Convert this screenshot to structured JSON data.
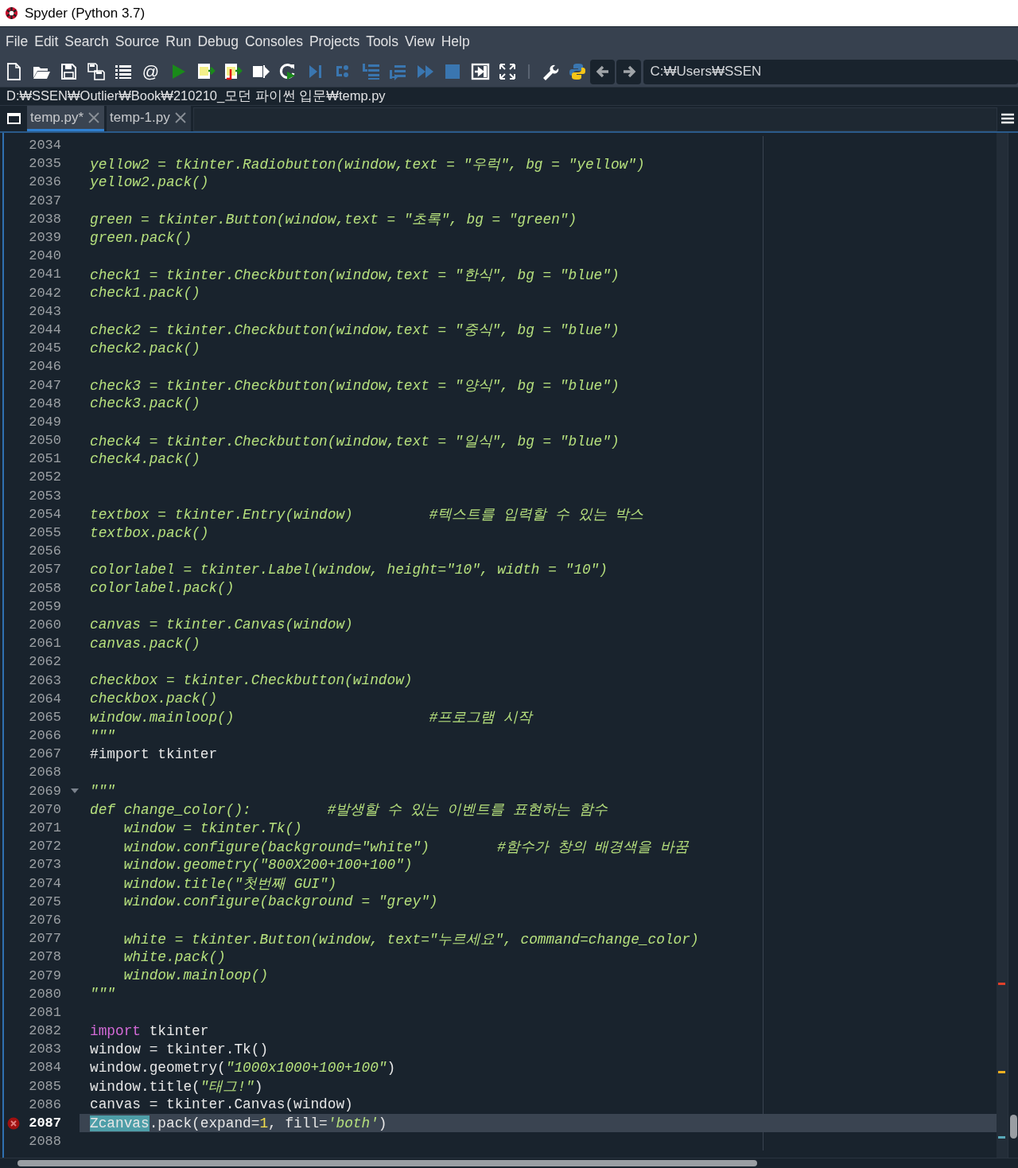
{
  "window": {
    "title": "Spyder (Python 3.7)"
  },
  "menu": [
    "File",
    "Edit",
    "Search",
    "Source",
    "Run",
    "Debug",
    "Consoles",
    "Projects",
    "Tools",
    "View",
    "Help"
  ],
  "toolbar": {
    "at_symbol": "@",
    "working_directory": "C:₩Users₩SSEN"
  },
  "file_path": "D:₩SSEN₩Outlier₩Book₩210210_모던 파이썬 입문₩temp.py",
  "tabs": [
    {
      "label": "temp.py*",
      "selected": true
    },
    {
      "label": "temp-1.py",
      "selected": false
    }
  ],
  "editor": {
    "lines": [
      {
        "number": "2034",
        "current": false,
        "error": false,
        "fold": false
      },
      {
        "number": "2035",
        "current": false,
        "error": false,
        "fold": false,
        "segments": [
          {
            "text": "yellow2 = tkinter.Radiobutton(window,text = \"우럭\", bg = \"yellow\")",
            "kind": "string"
          }
        ]
      },
      {
        "number": "2036",
        "current": false,
        "error": false,
        "fold": false,
        "segments": [
          {
            "text": "yellow2.pack()",
            "kind": "string"
          }
        ]
      },
      {
        "number": "2037",
        "current": false,
        "error": false,
        "fold": false
      },
      {
        "number": "2038",
        "current": false,
        "error": false,
        "fold": false,
        "segments": [
          {
            "text": "green = tkinter.Button(window,text = \"초록\", bg = \"green\")",
            "kind": "string"
          }
        ]
      },
      {
        "number": "2039",
        "current": false,
        "error": false,
        "fold": false,
        "segments": [
          {
            "text": "green.pack()",
            "kind": "string"
          }
        ]
      },
      {
        "number": "2040",
        "current": false,
        "error": false,
        "fold": false
      },
      {
        "number": "2041",
        "current": false,
        "error": false,
        "fold": false,
        "segments": [
          {
            "text": "check1 = tkinter.Checkbutton(window,text = \"한식\", bg = \"blue\")",
            "kind": "string"
          }
        ]
      },
      {
        "number": "2042",
        "current": false,
        "error": false,
        "fold": false,
        "segments": [
          {
            "text": "check1.pack()",
            "kind": "string"
          }
        ]
      },
      {
        "number": "2043",
        "current": false,
        "error": false,
        "fold": false
      },
      {
        "number": "2044",
        "current": false,
        "error": false,
        "fold": false,
        "segments": [
          {
            "text": "check2 = tkinter.Checkbutton(window,text = \"중식\", bg = \"blue\")",
            "kind": "string"
          }
        ]
      },
      {
        "number": "2045",
        "current": false,
        "error": false,
        "fold": false,
        "segments": [
          {
            "text": "check2.pack()",
            "kind": "string"
          }
        ]
      },
      {
        "number": "2046",
        "current": false,
        "error": false,
        "fold": false
      },
      {
        "number": "2047",
        "current": false,
        "error": false,
        "fold": false,
        "segments": [
          {
            "text": "check3 = tkinter.Checkbutton(window,text = \"양식\", bg = \"blue\")",
            "kind": "string"
          }
        ]
      },
      {
        "number": "2048",
        "current": false,
        "error": false,
        "fold": false,
        "segments": [
          {
            "text": "check3.pack()",
            "kind": "string"
          }
        ]
      },
      {
        "number": "2049",
        "current": false,
        "error": false,
        "fold": false
      },
      {
        "number": "2050",
        "current": false,
        "error": false,
        "fold": false,
        "segments": [
          {
            "text": "check4 = tkinter.Checkbutton(window,text = \"일식\", bg = \"blue\")",
            "kind": "string"
          }
        ]
      },
      {
        "number": "2051",
        "current": false,
        "error": false,
        "fold": false,
        "segments": [
          {
            "text": "check4.pack()",
            "kind": "string"
          }
        ]
      },
      {
        "number": "2052",
        "current": false,
        "error": false,
        "fold": false
      },
      {
        "number": "2053",
        "current": false,
        "error": false,
        "fold": false
      },
      {
        "number": "2054",
        "current": false,
        "error": false,
        "fold": false,
        "segments": [
          {
            "text": "textbox = tkinter.Entry(window)         #텍스트를 입력할 수 있는 박스",
            "kind": "string"
          }
        ]
      },
      {
        "number": "2055",
        "current": false,
        "error": false,
        "fold": false,
        "segments": [
          {
            "text": "textbox.pack()",
            "kind": "string"
          }
        ]
      },
      {
        "number": "2056",
        "current": false,
        "error": false,
        "fold": false
      },
      {
        "number": "2057",
        "current": false,
        "error": false,
        "fold": false,
        "segments": [
          {
            "text": "colorlabel = tkinter.Label(window, height=\"10\", width = \"10\")",
            "kind": "string"
          }
        ]
      },
      {
        "number": "2058",
        "current": false,
        "error": false,
        "fold": false,
        "segments": [
          {
            "text": "colorlabel.pack()",
            "kind": "string"
          }
        ]
      },
      {
        "number": "2059",
        "current": false,
        "error": false,
        "fold": false
      },
      {
        "number": "2060",
        "current": false,
        "error": false,
        "fold": false,
        "segments": [
          {
            "text": "canvas = tkinter.Canvas(window)",
            "kind": "string"
          }
        ]
      },
      {
        "number": "2061",
        "current": false,
        "error": false,
        "fold": false,
        "segments": [
          {
            "text": "canvas.pack()",
            "kind": "string"
          }
        ]
      },
      {
        "number": "2062",
        "current": false,
        "error": false,
        "fold": false
      },
      {
        "number": "2063",
        "current": false,
        "error": false,
        "fold": false,
        "segments": [
          {
            "text": "checkbox = tkinter.Checkbutton(window)",
            "kind": "string"
          }
        ]
      },
      {
        "number": "2064",
        "current": false,
        "error": false,
        "fold": false,
        "segments": [
          {
            "text": "checkbox.pack()",
            "kind": "string"
          }
        ]
      },
      {
        "number": "2065",
        "current": false,
        "error": false,
        "fold": false,
        "segments": [
          {
            "text": "window.mainloop()                       #프로그램 시작",
            "kind": "string"
          }
        ]
      },
      {
        "number": "2066",
        "current": false,
        "error": false,
        "fold": false,
        "segments": [
          {
            "text": "\"\"\"",
            "kind": "string"
          }
        ]
      },
      {
        "number": "2067",
        "current": false,
        "error": false,
        "fold": false,
        "segments": [
          {
            "text": "#import tkinter",
            "kind": "plain"
          }
        ]
      },
      {
        "number": "2068",
        "current": false,
        "error": false,
        "fold": false
      },
      {
        "number": "2069",
        "current": false,
        "error": false,
        "fold": true,
        "segments": [
          {
            "text": "\"\"\"",
            "kind": "string"
          }
        ]
      },
      {
        "number": "2070",
        "current": false,
        "error": false,
        "fold": false,
        "segments": [
          {
            "text": "def change_color():         #발생할 수 있는 이벤트를 표현하는 함수",
            "kind": "string"
          }
        ]
      },
      {
        "number": "2071",
        "current": false,
        "error": false,
        "fold": false,
        "segments": [
          {
            "text": "    window = tkinter.Tk()",
            "kind": "string"
          }
        ]
      },
      {
        "number": "2072",
        "current": false,
        "error": false,
        "fold": false,
        "segments": [
          {
            "text": "    window.configure(background=\"white\")        #함수가 창의 배경색을 바꿈",
            "kind": "string"
          }
        ]
      },
      {
        "number": "2073",
        "current": false,
        "error": false,
        "fold": false,
        "segments": [
          {
            "text": "    window.geometry(\"800X200+100+100\")",
            "kind": "string"
          }
        ]
      },
      {
        "number": "2074",
        "current": false,
        "error": false,
        "fold": false,
        "segments": [
          {
            "text": "    window.title(\"첫번째 GUI\")",
            "kind": "string"
          }
        ]
      },
      {
        "number": "2075",
        "current": false,
        "error": false,
        "fold": false,
        "segments": [
          {
            "text": "    window.configure(background = \"grey\")",
            "kind": "string"
          }
        ]
      },
      {
        "number": "2076",
        "current": false,
        "error": false,
        "fold": false
      },
      {
        "number": "2077",
        "current": false,
        "error": false,
        "fold": false,
        "segments": [
          {
            "text": "    white = tkinter.Button(window, text=\"누르세요\", command=change_color)",
            "kind": "string"
          }
        ]
      },
      {
        "number": "2078",
        "current": false,
        "error": false,
        "fold": false,
        "segments": [
          {
            "text": "    white.pack()",
            "kind": "string"
          }
        ]
      },
      {
        "number": "2079",
        "current": false,
        "error": false,
        "fold": false,
        "segments": [
          {
            "text": "    window.mainloop()",
            "kind": "string"
          }
        ]
      },
      {
        "number": "2080",
        "current": false,
        "error": false,
        "fold": false,
        "segments": [
          {
            "text": "\"\"\"",
            "kind": "string"
          }
        ]
      },
      {
        "number": "2081",
        "current": false,
        "error": false,
        "fold": false
      },
      {
        "number": "2082",
        "current": false,
        "error": false,
        "fold": false,
        "segments": [
          {
            "text": "import",
            "kind": "keyword"
          },
          {
            "text": " tkinter",
            "kind": "plain"
          }
        ]
      },
      {
        "number": "2083",
        "current": false,
        "error": false,
        "fold": false,
        "segments": [
          {
            "text": "window = tkinter.Tk()",
            "kind": "plain"
          }
        ]
      },
      {
        "number": "2084",
        "current": false,
        "error": false,
        "fold": false,
        "segments": [
          {
            "text": "window.geometry(",
            "kind": "plain"
          },
          {
            "text": "\"1000x1000+100+100\"",
            "kind": "string"
          },
          {
            "text": ")",
            "kind": "plain"
          }
        ]
      },
      {
        "number": "2085",
        "current": false,
        "error": false,
        "fold": false,
        "segments": [
          {
            "text": "window.title(",
            "kind": "plain"
          },
          {
            "text": "\"태그!\"",
            "kind": "string"
          },
          {
            "text": ")",
            "kind": "plain"
          }
        ]
      },
      {
        "number": "2086",
        "current": false,
        "error": false,
        "fold": false,
        "segments": [
          {
            "text": "canvas = tkinter.Canvas(window)",
            "kind": "plain"
          }
        ]
      },
      {
        "number": "2087",
        "current": true,
        "error": true,
        "fold": false,
        "segments": [
          {
            "text": "Zcanvas",
            "kind": "match"
          },
          {
            "text": ".pack(expand=",
            "kind": "plain"
          },
          {
            "text": "1",
            "kind": "number"
          },
          {
            "text": ", fill=",
            "kind": "plain"
          },
          {
            "text": "'both'",
            "kind": "string"
          },
          {
            "text": ")",
            "kind": "plain"
          }
        ]
      },
      {
        "number": "2088",
        "current": false,
        "error": false,
        "fold": false
      }
    ]
  }
}
